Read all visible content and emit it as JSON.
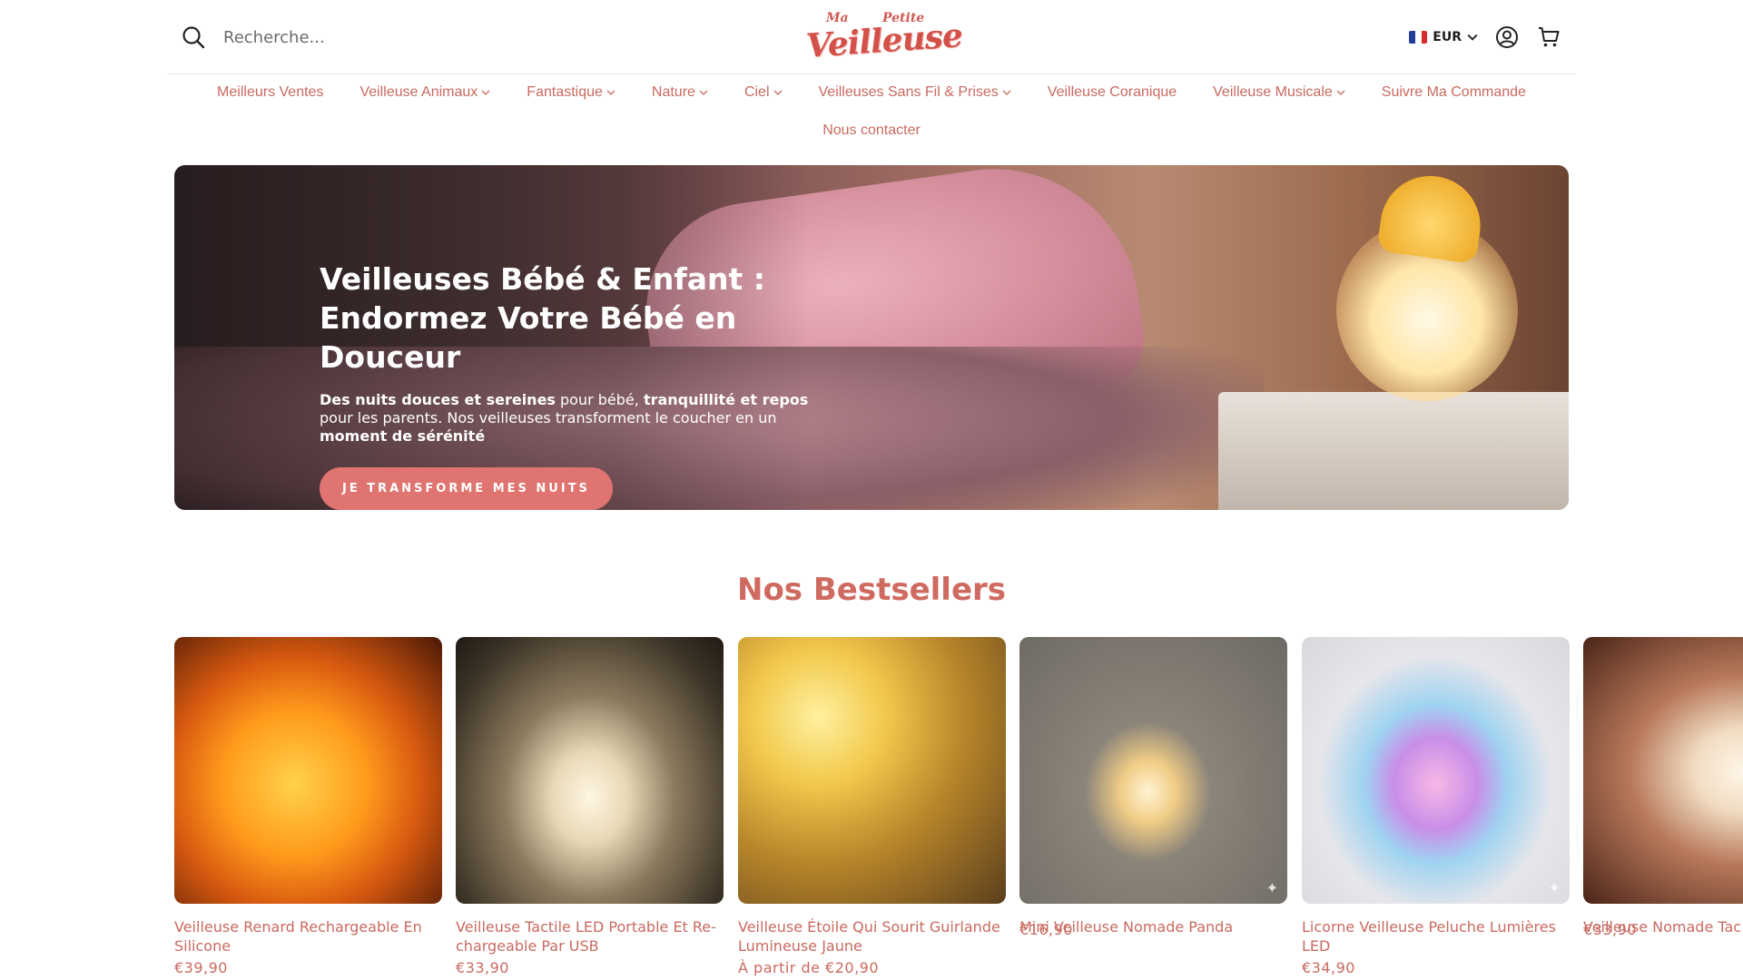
{
  "header": {
    "search_placeholder": "Recherche...",
    "logo": {
      "line1": "Ma",
      "line2": "Petite",
      "main": "Veilleuse"
    },
    "currency": "EUR"
  },
  "nav": {
    "items": [
      {
        "label": "Meilleurs Ventes",
        "dropdown": false
      },
      {
        "label": "Veilleuse Animaux",
        "dropdown": true
      },
      {
        "label": "Fantastique",
        "dropdown": true
      },
      {
        "label": "Nature",
        "dropdown": true
      },
      {
        "label": "Ciel",
        "dropdown": true
      },
      {
        "label": "Veilleuses Sans Fil & Prises",
        "dropdown": true
      },
      {
        "label": "Veilleuse Coranique",
        "dropdown": false
      },
      {
        "label": "Veilleuse Musicale",
        "dropdown": true
      },
      {
        "label": "Suivre Ma Commande",
        "dropdown": false
      },
      {
        "label": "Nous contacter",
        "dropdown": false
      }
    ]
  },
  "hero": {
    "title_line1": "Veilleuses Bébé & Enfant :",
    "title_line2": "Endormez Votre Bébé en Douceur",
    "desc_b1": "Des nuits douces et sereines",
    "desc_t1": " pour bébé, ",
    "desc_b2": "tranquillité et repos",
    "desc_t2": " pour les parents. Nos veilleuses transforment le coucher en un ",
    "desc_b3": "moment de sérénité",
    "cta": "JE TRANSFORME MES NUITS"
  },
  "bestsellers": {
    "title": "Nos Bestsellers",
    "products": [
      {
        "title_l1": "Veilleuse Renard Rechargeable En",
        "title_l2": "Silicone",
        "price": "€39,90"
      },
      {
        "title_l1": "Veilleuse Tactile LED Portable Et Re-",
        "title_l2": "chargeable Par USB",
        "price": "€33,90"
      },
      {
        "title_l1": "Veilleuse Étoile Qui Sourit Guirlande",
        "title_l2": "Lumineuse Jaune",
        "price": "À partir de €20,90"
      },
      {
        "title_l1": "Mini Veilleuse Nomade Panda",
        "title_l2": "",
        "price": "€16,90"
      },
      {
        "title_l1": "Licorne Veilleuse Peluche Lumières",
        "title_l2": "LED",
        "price": "€34,90"
      },
      {
        "title_l1": "Veilleuse Nomade Tac",
        "title_l2": "",
        "price": "€33,90"
      }
    ]
  },
  "colors": {
    "accent": "#c96a60",
    "cta": "#e07470",
    "heading": "#cf6a61"
  },
  "icons": [
    "search-icon",
    "flag-fr-icon",
    "chevron-down-icon",
    "account-icon",
    "cart-icon",
    "sparkle-icon"
  ]
}
